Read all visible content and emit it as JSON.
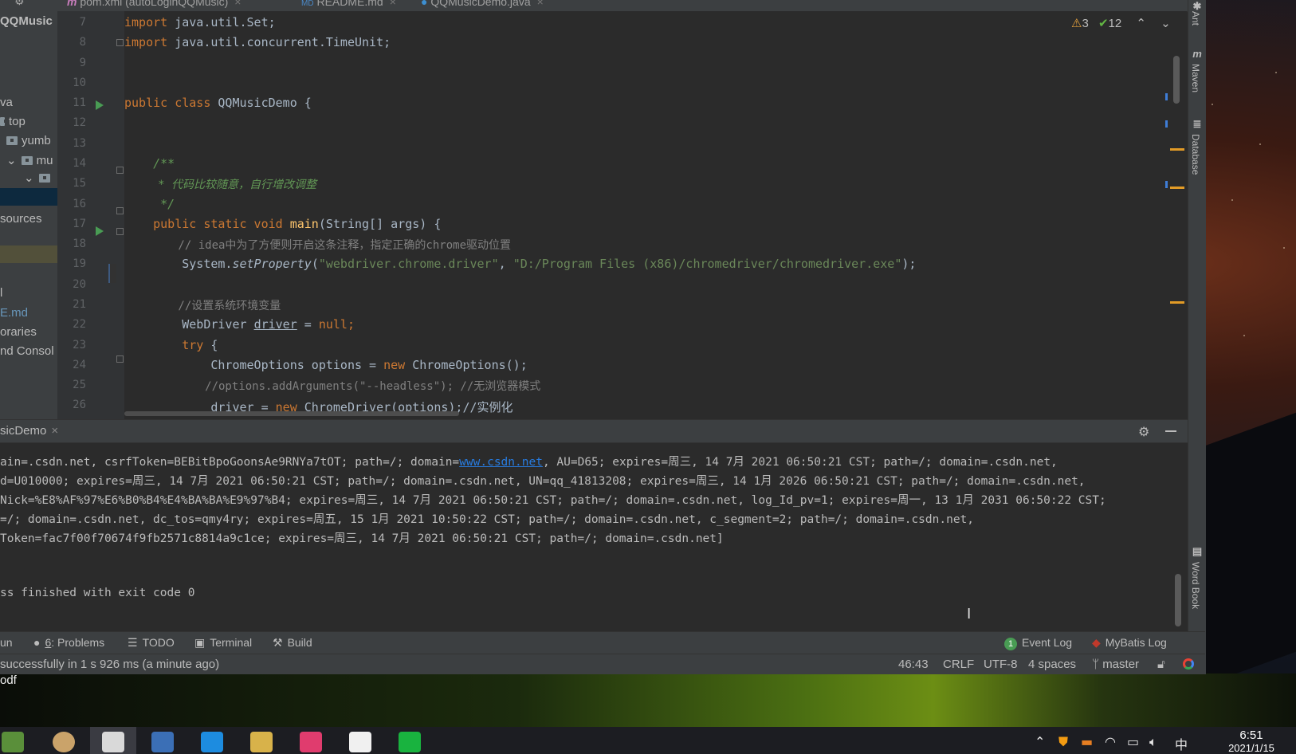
{
  "tabs": [
    {
      "label": "pom.xml (autoLoginQQMusic)",
      "icon": "maven-icon"
    },
    {
      "label": "README.md",
      "icon": "markdown-icon"
    },
    {
      "label": "QQMusicDemo.java",
      "icon": "java-class-icon",
      "active": true
    }
  ],
  "sidebar": {
    "title": "QQMusic",
    "items": [
      "va",
      "top",
      "yumb",
      "mu",
      "",
      "sources",
      "l",
      "E.md",
      "oraries",
      "nd Consol"
    ]
  },
  "editor": {
    "line_numbers": [
      "7",
      "8",
      "9",
      "10",
      "11",
      "12",
      "13",
      "14",
      "15",
      "16",
      "17",
      "18",
      "19",
      "20",
      "21",
      "22",
      "23",
      "24",
      "25",
      "26"
    ],
    "t": {
      "import": "import",
      "set": " java.util.Set;",
      "tu": " java.util.concurrent.TimeUnit;",
      "public": "public",
      "class": " class ",
      "cls_name": "QQMusicDemo {",
      "doc1": "    /**",
      "doc2": "     * 代码比较随意，自行增改调整",
      "doc3": "     */",
      "main_pre": "    public static void ",
      "main_fn": "main",
      "main_post": "(String[] args) {",
      "c18": "        // idea中为了方便则开启这条注释，指定正确的chrome驱动位置",
      "l19_pre": "        System.",
      "l19_fn": "setProperty",
      "l19_open": "(",
      "l19_s1": "\"webdriver.chrome.driver\"",
      "l19_sep": ", ",
      "l19_s2": "\"D:/Program Files (x86)/chromedriver/chromedriver.exe\"",
      "l19_close": ");",
      "c21": "        //设置系统环境变量",
      "l22_pre": "        WebDriver ",
      "l22_var": "driver",
      "l22_mid": " = ",
      "l22_null": "null",
      "l22_end": ";",
      "try": "        try",
      "try_brace": " {",
      "l24_pre": "            ChromeOptions options = ",
      "l24_new": "new",
      "l24_post": " ChromeOptions();",
      "c25": "            //options.addArguments(\"--headless\"); //无浏览器模式",
      "l26_pre": "            driver = ",
      "l26_new": "new",
      "l26_post": " ChromeDriver(options);//实例化"
    },
    "inspection": {
      "warnings": "3",
      "ok": "12"
    }
  },
  "run": {
    "tab_label": "sicDemo",
    "lines": [
      "ain=.csdn.net, csrfToken=BEBitBpoGoonsAe9RNYa7tOT; path=/; domain=",
      "d=U010000; expires=周三, 14 7月 2021 06:50:21 CST; path=/; domain=.csdn.net, UN=qq_41813208; expires=周三, 14 1月 2026 06:50:21 CST; path=/; domain=.csdn.net,",
      "Nick=%E8%AF%97%E6%B0%B4%E4%BA%BA%E9%97%B4; expires=周三, 14 7月 2021 06:50:21 CST; path=/; domain=.csdn.net, log_Id_pv=1; expires=周一, 13 1月 2031 06:50:22 CST;",
      "=/; domain=.csdn.net, dc_tos=qmy4ry; expires=周五, 15 1月 2021 10:50:22 CST; path=/; domain=.csdn.net, c_segment=2; path=/; domain=.csdn.net,",
      "Token=fac7f00f70674f9fb2571c8814a9c1ce; expires=周三, 14 7月 2021 06:50:21 CST; path=/; domain=.csdn.net]",
      "ss finished with exit code 0"
    ],
    "line0_link": "www.csdn.net",
    "line0_tail": ", AU=D65; expires=周三, 14 7月 2021 06:50:21 CST; path=/; domain=.csdn.net,"
  },
  "right_strip": [
    "Ant",
    "Maven",
    "Database",
    "Word Book"
  ],
  "bottom_tools": {
    "run": "un",
    "problems_num": "6",
    "problems": ": Problems",
    "todo": "TODO",
    "terminal": "Terminal",
    "build": "Build",
    "event_log_count": "1",
    "event_log": "Event Log",
    "mybatis_log": "MyBatis Log"
  },
  "status": {
    "message": "successfully in 1 s 926 ms (a minute ago)",
    "position": "46:43",
    "line_sep": "CRLF",
    "encoding": "UTF-8",
    "indent": "4 spaces",
    "branch": "master"
  },
  "desktop": {
    "label": "odf"
  },
  "taskbar": {
    "ime": "中",
    "time": "6:51",
    "date": "2021/1/15"
  },
  "colors": {
    "keyword": "#cc7832",
    "string": "#6a8759",
    "comment": "#808080",
    "doc": "#629755",
    "function": "#ffc66d",
    "link": "#287bde"
  }
}
